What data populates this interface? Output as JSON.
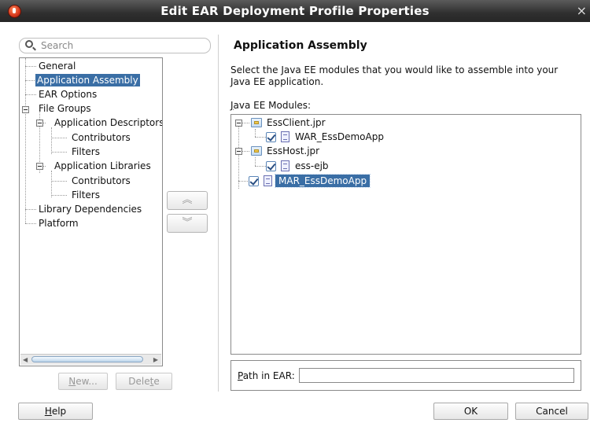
{
  "window": {
    "title": "Edit EAR Deployment Profile Properties",
    "close_glyph": "×"
  },
  "search": {
    "placeholder": "Search"
  },
  "nav": {
    "items": [
      {
        "label": "General"
      },
      {
        "label": "Application Assembly"
      },
      {
        "label": "EAR Options"
      },
      {
        "label": "File Groups"
      },
      {
        "label": "Application Descriptors"
      },
      {
        "label": "Contributors"
      },
      {
        "label": "Filters"
      },
      {
        "label": "Application Libraries"
      },
      {
        "label": "Contributors"
      },
      {
        "label": "Filters"
      },
      {
        "label": "Library Dependencies"
      },
      {
        "label": "Platform"
      }
    ],
    "selected": "Application Assembly",
    "new_button": {
      "mnemonic": "N",
      "rest": "ew..."
    },
    "delete_button": {
      "before": "Dele",
      "mnemonic": "t",
      "after": "e"
    }
  },
  "move": {
    "up_glyph": "︽",
    "down_glyph": "︾"
  },
  "main": {
    "heading": "Application Assembly",
    "description": "Select the Java EE modules that you would like to assemble into your Java EE application.",
    "modules_label_mnemonic": "J",
    "modules_label_rest": "ava EE Modules:",
    "modules": {
      "project1": {
        "name": "EssClient.jpr",
        "child": "WAR_EssDemoApp",
        "checked": true
      },
      "project2": {
        "name": "EssHost.jpr",
        "child": "ess-ejb",
        "checked": true
      },
      "standalone": {
        "name": "MAR_EssDemoApp",
        "checked": true,
        "selected": true
      }
    },
    "path_label_mnemonic": "P",
    "path_label_rest": "ath in EAR:",
    "path_value": ""
  },
  "footer": {
    "help": {
      "mnemonic": "H",
      "rest": "elp"
    },
    "ok": "OK",
    "cancel": "Cancel"
  },
  "colors": {
    "selection": "#3a6ea5",
    "titlebar": "#2f2f2f"
  }
}
